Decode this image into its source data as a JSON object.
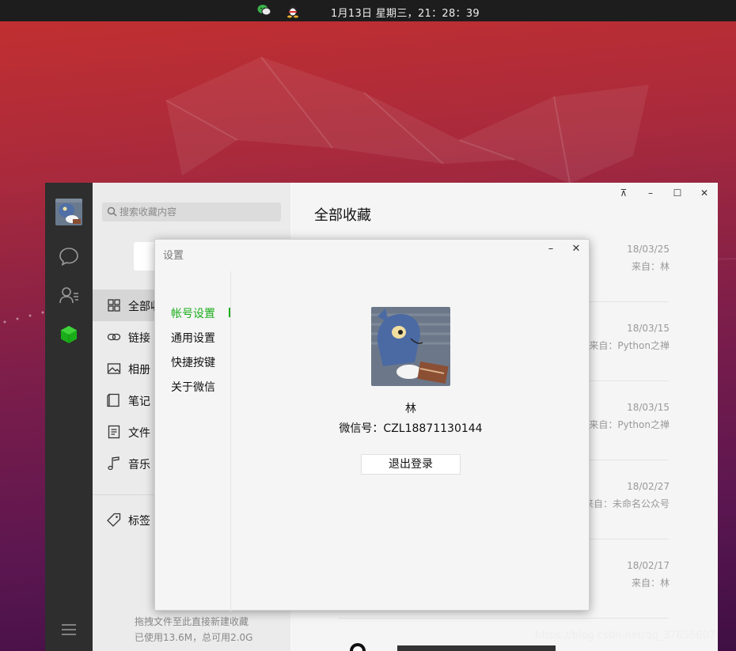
{
  "topbar": {
    "clock": "1月13日 星期三，21：28：39",
    "tray_icons": [
      "wechat-icon",
      "qq-icon"
    ]
  },
  "search": {
    "placeholder": "搜索收藏内容"
  },
  "categories": [
    {
      "label": "全部收藏",
      "icon": "grid-icon",
      "active": true
    },
    {
      "label": "链接",
      "icon": "link-icon"
    },
    {
      "label": "相册",
      "icon": "image-icon"
    },
    {
      "label": "笔记",
      "icon": "note-icon"
    },
    {
      "label": "文件",
      "icon": "file-icon"
    },
    {
      "label": "音乐",
      "icon": "music-icon"
    },
    {
      "label": "标签",
      "icon": "tag-icon"
    }
  ],
  "storage": {
    "hint": "拖拽文件至此直接新建收藏",
    "usage": "已使用13.6M，总可用2.0G"
  },
  "content": {
    "title": "全部收藏",
    "items": [
      {
        "date": "18/03/25",
        "source": "来自：林"
      },
      {
        "date": "18/03/15",
        "source": "来自：Python之禅"
      },
      {
        "date": "18/03/15",
        "source": "来自：Python之禅"
      },
      {
        "date": "18/02/27",
        "source": "来自：未命名公众号"
      },
      {
        "date": "18/02/17",
        "source": "来自：林"
      }
    ]
  },
  "dialog": {
    "title": "设置",
    "menu": [
      "帐号设置",
      "通用设置",
      "快捷按键",
      "关于微信"
    ],
    "active_menu": 0,
    "profile": {
      "name": "林",
      "wechat_id": "微信号：CZL18871130144"
    },
    "logout_label": "退出登录"
  },
  "watermark": "https://blog.csdn.net/qq_37655607",
  "colors": {
    "accent": "#1aad19",
    "sidebar": "#2e2e2e",
    "topbar": "#1d1d1d"
  }
}
